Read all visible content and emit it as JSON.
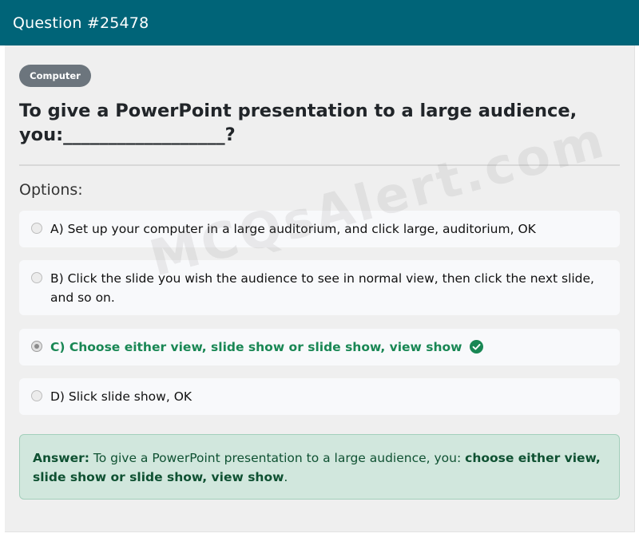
{
  "header": {
    "title": "Question #25478"
  },
  "category": {
    "label": "Computer"
  },
  "question": {
    "text": "To give a PowerPoint presentation to a large audience, you:__________________?"
  },
  "options_heading": "Options:",
  "options": [
    {
      "label": "A) Set up your computer in a large auditorium, and click large, auditorium, OK",
      "selected": false,
      "correct": false
    },
    {
      "label": "B) Click the slide you wish the audience to see in normal view, then click the next slide, and so on.",
      "selected": false,
      "correct": false
    },
    {
      "label": "C) Choose either view, slide show or slide show, view show",
      "selected": true,
      "correct": true
    },
    {
      "label": "D) Slick slide show, OK",
      "selected": false,
      "correct": false
    }
  ],
  "answer": {
    "prefix": "Answer:",
    "text": "To give a PowerPoint presentation to a large audience, you:",
    "highlight": "choose either view, slide show or slide show, view show",
    "suffix": "."
  },
  "watermark": "MCQsAlert.com",
  "colors": {
    "header_bg": "#006478",
    "badge_bg": "#6c757d",
    "correct_green": "#198754",
    "answer_bg": "#d1e7dd",
    "answer_text": "#0f5132"
  },
  "icons": {
    "correct": "check-circle-icon"
  }
}
